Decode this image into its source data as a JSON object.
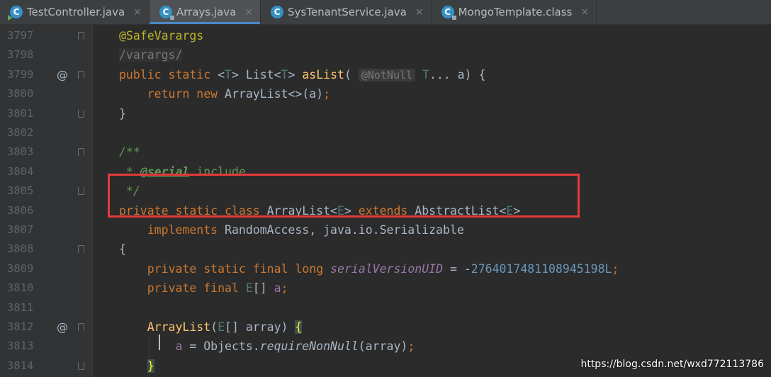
{
  "tabs": [
    {
      "label": "TestController.java",
      "active": false,
      "icon": "java-class-runnable-icon"
    },
    {
      "label": "Arrays.java",
      "active": true,
      "icon": "java-class-readonly-icon"
    },
    {
      "label": "SysTenantService.java",
      "active": false,
      "icon": "java-class-icon"
    },
    {
      "label": "MongoTemplate.class",
      "active": false,
      "icon": "java-class-readonly-icon"
    }
  ],
  "tab_icon_letter": "C",
  "tab_close_glyph": "×",
  "line_numbers": [
    "3797",
    "3798",
    "3799",
    "3800",
    "3801",
    "3802",
    "3803",
    "3804",
    "3805",
    "3806",
    "3807",
    "3808",
    "3809",
    "3810",
    "3811",
    "3812",
    "3813",
    "3814"
  ],
  "override_marker": "@",
  "code": {
    "l3797": {
      "ann": "@SafeVarargs"
    },
    "l3798": {
      "text": "/varargs/"
    },
    "l3799": {
      "kw1": "public",
      "kw2": "static",
      "lt": "<",
      "t1": "T",
      "gt": ">",
      "list": " List",
      "lt2": "<",
      "t2": "T",
      "gt2": ">",
      "fn": "asList",
      "open": "(",
      "hint": "@NotNull",
      "t3": "T",
      "rest": "... a) {"
    },
    "l3800": {
      "kw1": "return",
      "kw2": "new",
      "rest": "ArrayList<>(a)",
      "semi": ";"
    },
    "l3801": {
      "text": "}"
    },
    "l3803": {
      "cm": "/**"
    },
    "l3804": {
      "star": " * ",
      "tag": "@serial",
      "text": " include"
    },
    "l3805": {
      "cm": " */"
    },
    "l3806": {
      "kw1": "private",
      "kw2": "static",
      "kw3": "class",
      "name": "ArrayList<",
      "e1": "E",
      "gt": ">",
      "kw4": "extends",
      "base": "AbstractList<",
      "e2": "E",
      "gt2": ">"
    },
    "l3807": {
      "kw": "implements",
      "rest": "RandomAccess, java.io.Serializable"
    },
    "l3808": {
      "text": "{"
    },
    "l3809": {
      "kw1": "private",
      "kw2": "static",
      "kw3": "final",
      "kw4": "long",
      "field": "serialVersionUID",
      "eq": " = -",
      "num": "2764017481108945198L",
      "semi": ";"
    },
    "l3810": {
      "kw1": "private",
      "kw2": "final",
      "e": "E",
      "arr": "[] ",
      "field": "a",
      "semi": ";"
    },
    "l3812": {
      "fn": "ArrayList",
      "open": "(",
      "e": "E",
      "rest": "[] array) ",
      "brace": "{"
    },
    "l3813": {
      "field": "a",
      "eq": " = Objects.",
      "call": "requireNonNull",
      "rest": "(array)",
      "semi": ";"
    },
    "l3814": {
      "brace": "}"
    }
  },
  "watermark": "https://blog.csdn.net/wxd772113786",
  "colors": {
    "keyword": "#CC7832",
    "annotation": "#BBB529",
    "type_param": "#507874",
    "function": "#FFC66D",
    "number": "#6897BB",
    "comment": "#629755",
    "field": "#9876AA",
    "highlight_box": "#E43A3A"
  }
}
